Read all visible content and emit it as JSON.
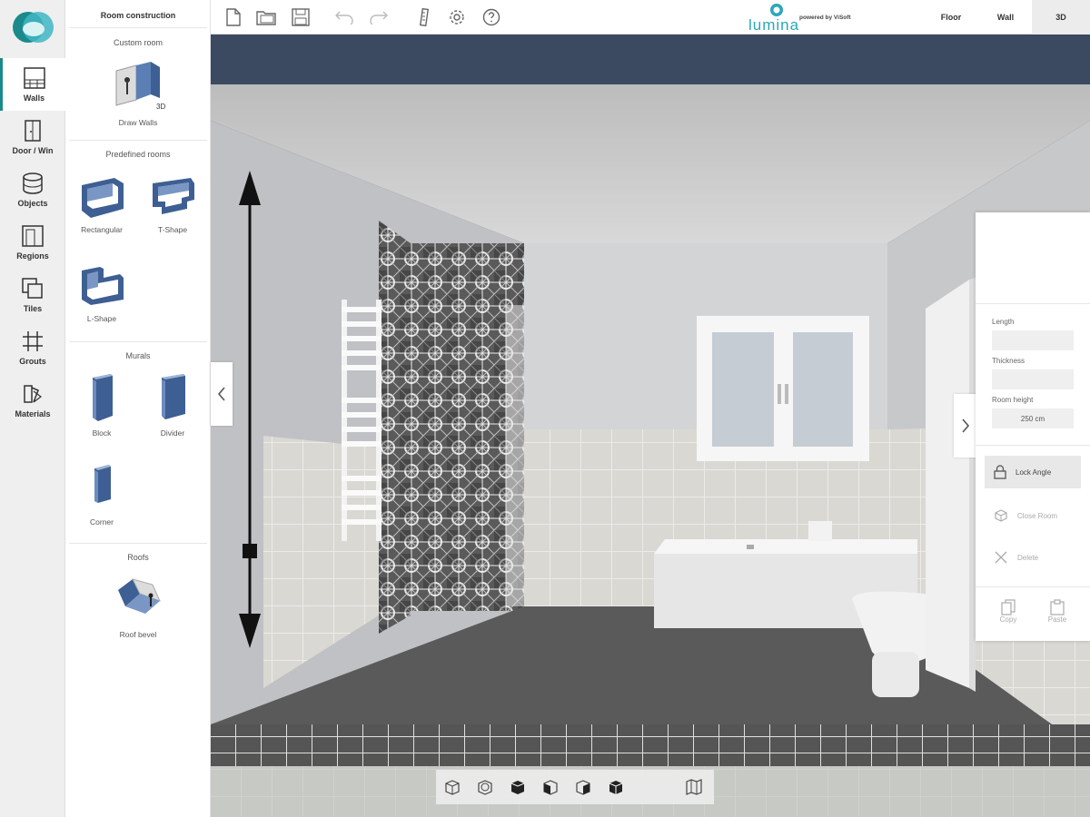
{
  "brand": {
    "name": "lumina",
    "powered": "powered by ViSoft"
  },
  "nav": [
    {
      "label": "Walls",
      "icon": "walls-icon"
    },
    {
      "label": "Door / Win",
      "icon": "door-icon"
    },
    {
      "label": "Objects",
      "icon": "objects-icon"
    },
    {
      "label": "Regions",
      "icon": "regions-icon"
    },
    {
      "label": "Tiles",
      "icon": "tiles-icon"
    },
    {
      "label": "Grouts",
      "icon": "grouts-icon"
    },
    {
      "label": "Materials",
      "icon": "materials-icon"
    }
  ],
  "catalog": {
    "title": "Room construction",
    "custom_room": "Custom room",
    "draw_walls": "Draw Walls",
    "predefined": "Predefined rooms",
    "rooms": [
      "Rectangular",
      "T-Shape",
      "L-Shape"
    ],
    "murals": "Murals",
    "mural_items": [
      "Block",
      "Divider",
      "Corner"
    ],
    "roofs": "Roofs",
    "roof_item": "Roof bevel"
  },
  "views": [
    "Floor",
    "Wall",
    "3D"
  ],
  "active_view": "3D",
  "props": {
    "length_label": "Length",
    "length_value": "",
    "thickness_label": "Thickness",
    "thickness_value": "",
    "height_label": "Room height",
    "height_value": "250 cm",
    "lock_angle": "Lock Angle",
    "close_room": "Close Room",
    "delete": "Delete",
    "copy": "Copy",
    "paste": "Paste"
  },
  "colors": {
    "accent": "#1a8a8c",
    "brand": "#2aa7b8"
  }
}
